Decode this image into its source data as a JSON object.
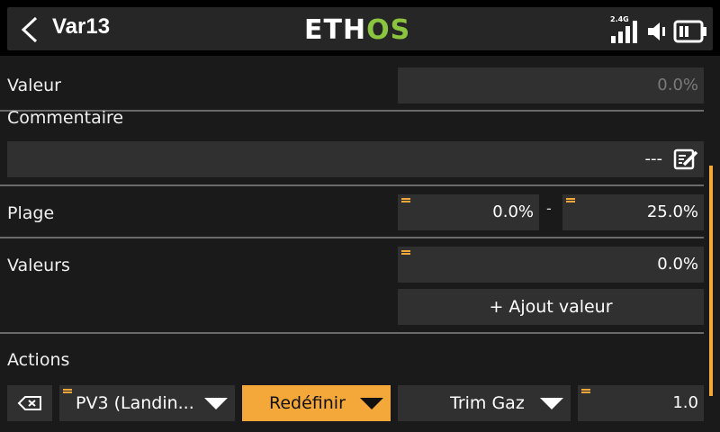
{
  "header": {
    "title": "Var13",
    "logo_part1": "ETH",
    "logo_part2": "OS",
    "rf_label": "2.4G"
  },
  "valeur": {
    "label": "Valeur",
    "value": "0.0%"
  },
  "commentaire": {
    "label": "Commentaire",
    "value": "---"
  },
  "plage": {
    "label": "Plage",
    "min": "0.0%",
    "separator": "-",
    "max": "25.0%"
  },
  "valeurs": {
    "label": "Valeurs",
    "value": "0.0%",
    "add_button": "+ Ajout valeur"
  },
  "actions": {
    "label": "Actions",
    "source": "PV3 (Landin...",
    "mode": "Redéfinir",
    "target": "Trim Gaz",
    "amount": "1.0"
  },
  "colors": {
    "accent": "#f4a83a",
    "logo_green": "#8bc53f",
    "field_bg": "#303030"
  },
  "icons": [
    "chevron-left-icon",
    "signal-icon",
    "speaker-icon",
    "battery-icon",
    "edit-icon",
    "clear-icon"
  ]
}
